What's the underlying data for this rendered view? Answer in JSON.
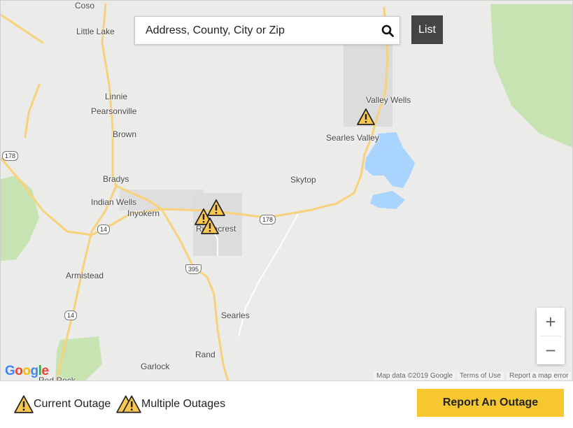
{
  "search": {
    "placeholder": "Address, County, City or Zip"
  },
  "list_button": "List",
  "places": {
    "coso": "Coso",
    "little_lake": "Little Lake",
    "linnie": "Linnie",
    "pearsonville": "Pearsonville",
    "brown": "Brown",
    "bradys": "Bradys",
    "indian_wells": "Indian Wells",
    "inyokern": "Inyokern",
    "ridgecrest": "Ridgecrest",
    "armistead": "Armistead",
    "searles": "Searles",
    "rand": "Rand",
    "garlock": "Garlock",
    "red_rock": "Red Rock",
    "valley_wells": "Valley Wells",
    "searles_valley": "Searles Valley",
    "skytop": "Skytop"
  },
  "shields": {
    "sr178_west": "178",
    "sr178_east": "178",
    "sr14_north": "14",
    "sr14_south": "14",
    "us395": "395"
  },
  "map": {
    "zoom_in": "+",
    "zoom_out": "−",
    "google_logo": "Google",
    "map_data": "Map data ©2019 Google",
    "terms": "Terms of Use",
    "report_error": "Report a map error"
  },
  "legend": {
    "current_outage": "Current Outage",
    "multiple_outages": "Multiple Outages"
  },
  "report_button": "Report An Outage",
  "colors": {
    "marker_fill": "#f9c74f",
    "road": "#f8d27a",
    "water": "#a8d4ff",
    "park": "#b8dca0",
    "report_button": "#f7c72f"
  }
}
